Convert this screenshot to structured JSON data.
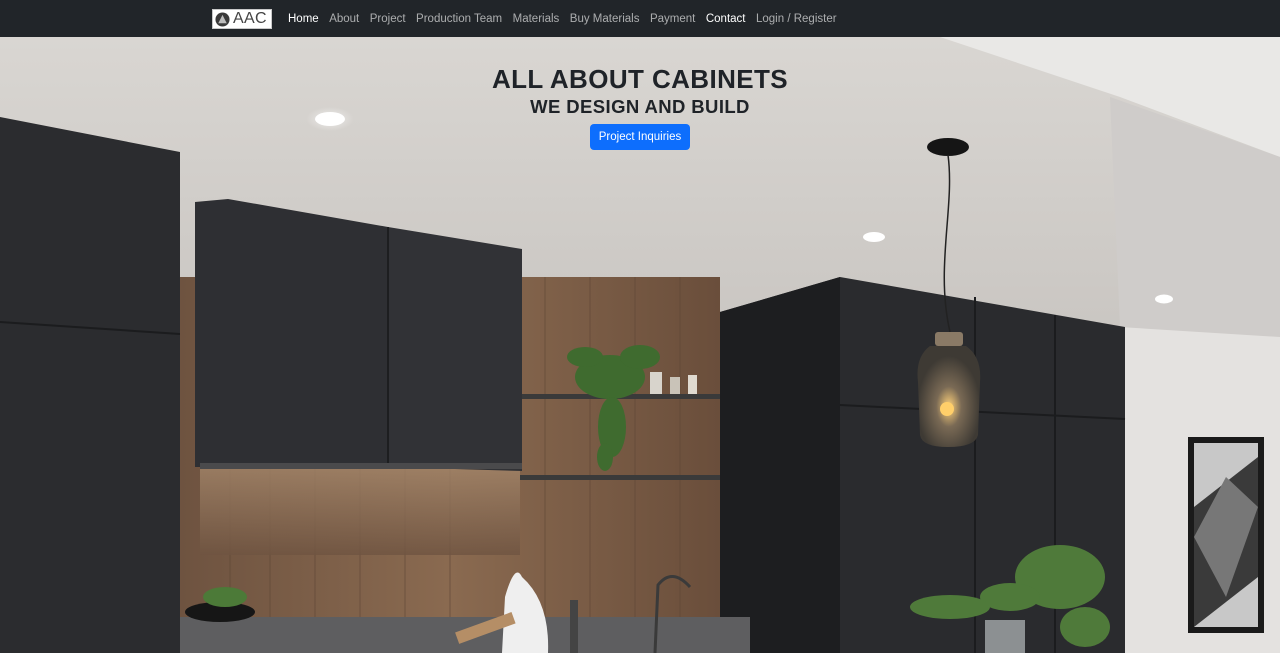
{
  "navbar": {
    "brand_text": "AAC",
    "links": [
      {
        "label": "Home"
      },
      {
        "label": "About"
      },
      {
        "label": "Project"
      },
      {
        "label": "Production Team"
      },
      {
        "label": "Materials"
      },
      {
        "label": "Buy Materials"
      },
      {
        "label": "Payment"
      },
      {
        "label": "Contact"
      },
      {
        "label": "Login / Register"
      }
    ]
  },
  "hero": {
    "title": "ALL ABOUT CABINETS",
    "subtitle": "WE DESIGN AND BUILD",
    "button_label": "Project Inquiries",
    "background_icon": "kitchen-photo"
  },
  "colors": {
    "navbar_bg": "#212529",
    "accent": "#0d6efd",
    "title_text": "#1f2328"
  }
}
